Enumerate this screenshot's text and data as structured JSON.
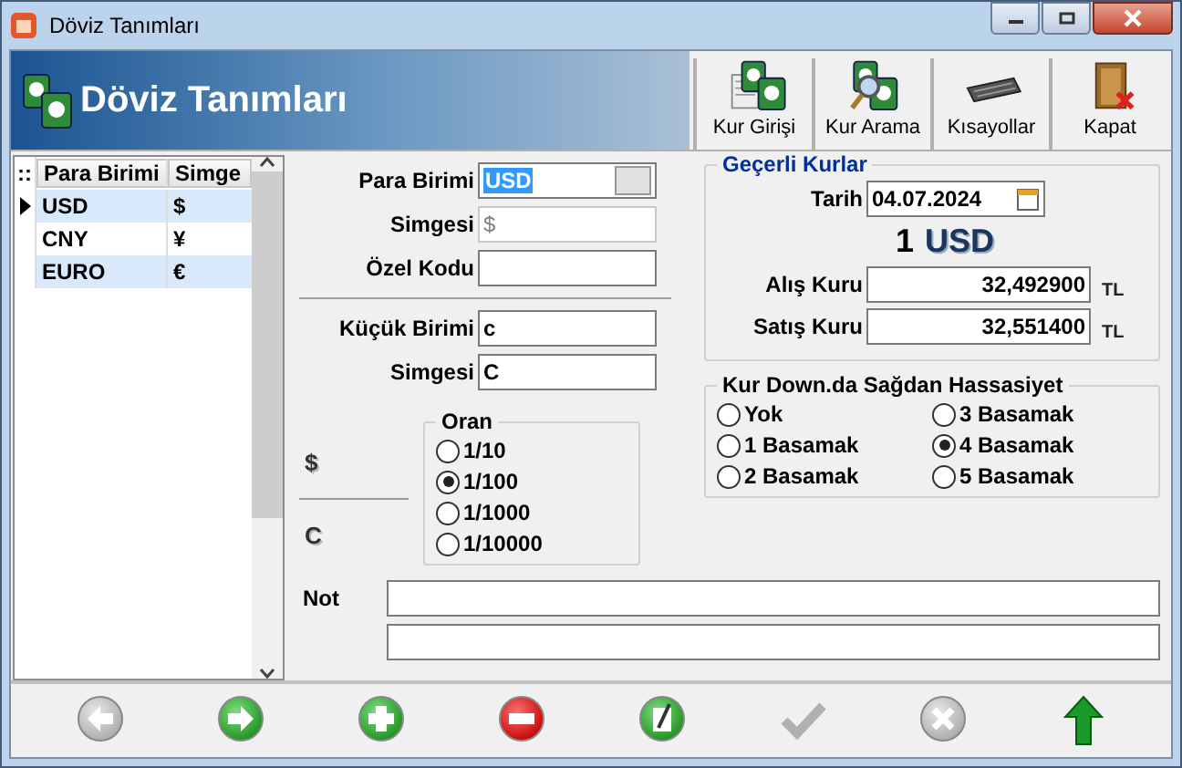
{
  "window": {
    "title": "Döviz Tanımları"
  },
  "header": {
    "title": "Döviz Tanımları"
  },
  "toolbar": [
    {
      "label": "Kur Girişi",
      "kind": "entry"
    },
    {
      "label": "Kur Arama",
      "kind": "search"
    },
    {
      "label": "Kısayollar",
      "kind": "keyboard"
    },
    {
      "label": "Kapat",
      "kind": "exit"
    }
  ],
  "grid": {
    "corner": "::",
    "columns": [
      "Para Birimi",
      "Simge"
    ],
    "rows": [
      {
        "cells": [
          "USD",
          "$"
        ],
        "selected": true
      },
      {
        "cells": [
          "CNY",
          "¥"
        ],
        "selected": false
      },
      {
        "cells": [
          "EURO",
          "€"
        ],
        "selected": false
      }
    ]
  },
  "currency_fields": [
    {
      "label": "Para Birimi",
      "value": "USD",
      "kind": "lookup"
    },
    {
      "label": "Simgesi",
      "value": "$",
      "disabled": true
    },
    {
      "label": "Özel Kodu"
    }
  ],
  "subunit_fields": [
    {
      "label": "Küçük Birimi",
      "value": "c"
    },
    {
      "label": "Simgesi",
      "value": "C"
    }
  ],
  "ratio_symbols": [
    "$",
    "C"
  ],
  "ratio": {
    "title": "Oran",
    "options": [
      {
        "label": "1/10",
        "selected": false
      },
      {
        "label": "1/100",
        "selected": true
      },
      {
        "label": "1/1000",
        "selected": false
      },
      {
        "label": "1/10000",
        "selected": false
      }
    ]
  },
  "rates": {
    "title": "Geçerli Kurlar",
    "date_label": "Tarih",
    "date": "04.07.2024",
    "amount": "1",
    "currency": "USD",
    "rows": [
      {
        "label": "Alış Kuru",
        "value": "32,492900",
        "unit": "TL"
      },
      {
        "label": "Satış Kuru",
        "value": "32,551400",
        "unit": "TL"
      }
    ]
  },
  "precision": {
    "title": "Kur Down.da Sağdan Hassasiyet",
    "options": [
      {
        "label": "Yok",
        "selected": false
      },
      {
        "label": "1 Basamak",
        "selected": false
      },
      {
        "label": "2 Basamak",
        "selected": false
      },
      {
        "label": "3 Basamak",
        "selected": false
      },
      {
        "label": "4 Basamak",
        "selected": true
      },
      {
        "label": "5 Basamak",
        "selected": false
      }
    ]
  },
  "note": {
    "label": "Not"
  },
  "bottom_buttons": [
    {
      "kind": "back",
      "disabled": true
    },
    {
      "kind": "forward",
      "disabled": false
    },
    {
      "kind": "add",
      "disabled": false
    },
    {
      "kind": "delete",
      "disabled": false
    },
    {
      "kind": "edit",
      "disabled": false
    },
    {
      "kind": "confirm",
      "disabled": true
    },
    {
      "kind": "cancel",
      "disabled": true
    },
    {
      "kind": "up",
      "disabled": false
    }
  ]
}
